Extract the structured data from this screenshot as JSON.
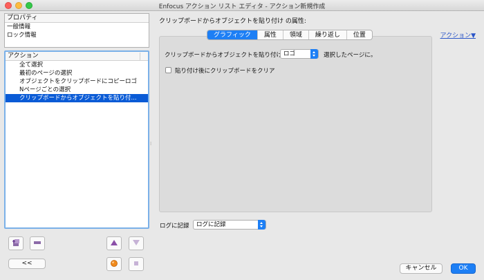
{
  "window": {
    "title": "Enfocus アクション リスト エディタ - アクション新規作成"
  },
  "properties": {
    "header": "プロパティ",
    "items": [
      "一般情報",
      "ロック情報"
    ]
  },
  "actions": {
    "header": "アクション",
    "items": [
      "全て選択",
      "最初のページの選択",
      "オブジェクトをクリップボードにコピーロゴ",
      "Nページごとの選択",
      "クリップボードからオブジェクトを貼り付..."
    ],
    "selected_index": 4
  },
  "bottom_buttons": {
    "collapse_label": "<<"
  },
  "editor": {
    "section_title": "クリップボードからオブジェクトを貼り付け の属性:",
    "action_menu_label": "アクション▼",
    "tabs": [
      "グラフィック",
      "属性",
      "領域",
      "繰り返し",
      "位置"
    ],
    "active_tab": 0,
    "paste_label": "クリップボードからオブジェクトを貼り付け",
    "paste_select_value": "ロゴ",
    "selected_page_label": "選択したページに。",
    "clear_clipboard_label": "貼り付け後にクリップボードをクリア",
    "clear_clipboard_checked": false
  },
  "log": {
    "label": "ログに記録",
    "select_value": "ログに記録"
  },
  "dialog": {
    "cancel_label": "キャンセル",
    "ok_label": "OK"
  },
  "colors": {
    "accent": "#1d7ff5",
    "selection": "#0a5bd6",
    "link": "#2a55c8"
  }
}
